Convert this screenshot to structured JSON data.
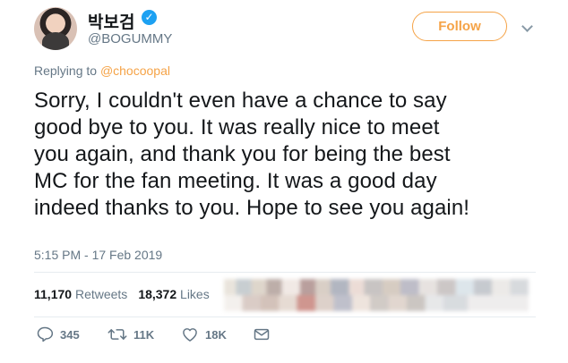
{
  "profile": {
    "display_name": "박보검",
    "handle": "@BOGUMMY",
    "verified": true
  },
  "follow_button": {
    "label": "Follow"
  },
  "reply": {
    "prefix": "Replying to",
    "to": "@chocoopal"
  },
  "tweet": {
    "lines": [
      "Sorry, I couldn't even have a chance to say",
      "good bye to you. It was really nice to meet",
      "you again, and thank you for being the best",
      "MC for the fan meeting. It was a good day",
      "indeed thanks to you. Hope to see you again!"
    ],
    "timestamp": "5:15 PM - 17 Feb 2019"
  },
  "stats": {
    "retweets_count": "11,170",
    "retweets_label": "Retweets",
    "likes_count": "18,372",
    "likes_label": "Likes"
  },
  "actions": {
    "reply_count": "345",
    "retweet_count": "11K",
    "like_count": "18K"
  },
  "colors": {
    "accent": "#f5a347",
    "muted": "#657786",
    "text": "#14171a",
    "verified": "#1da1f2"
  },
  "icons": [
    "verified-icon",
    "chevron-down-icon",
    "reply-icon",
    "retweet-icon",
    "like-icon",
    "message-icon"
  ]
}
